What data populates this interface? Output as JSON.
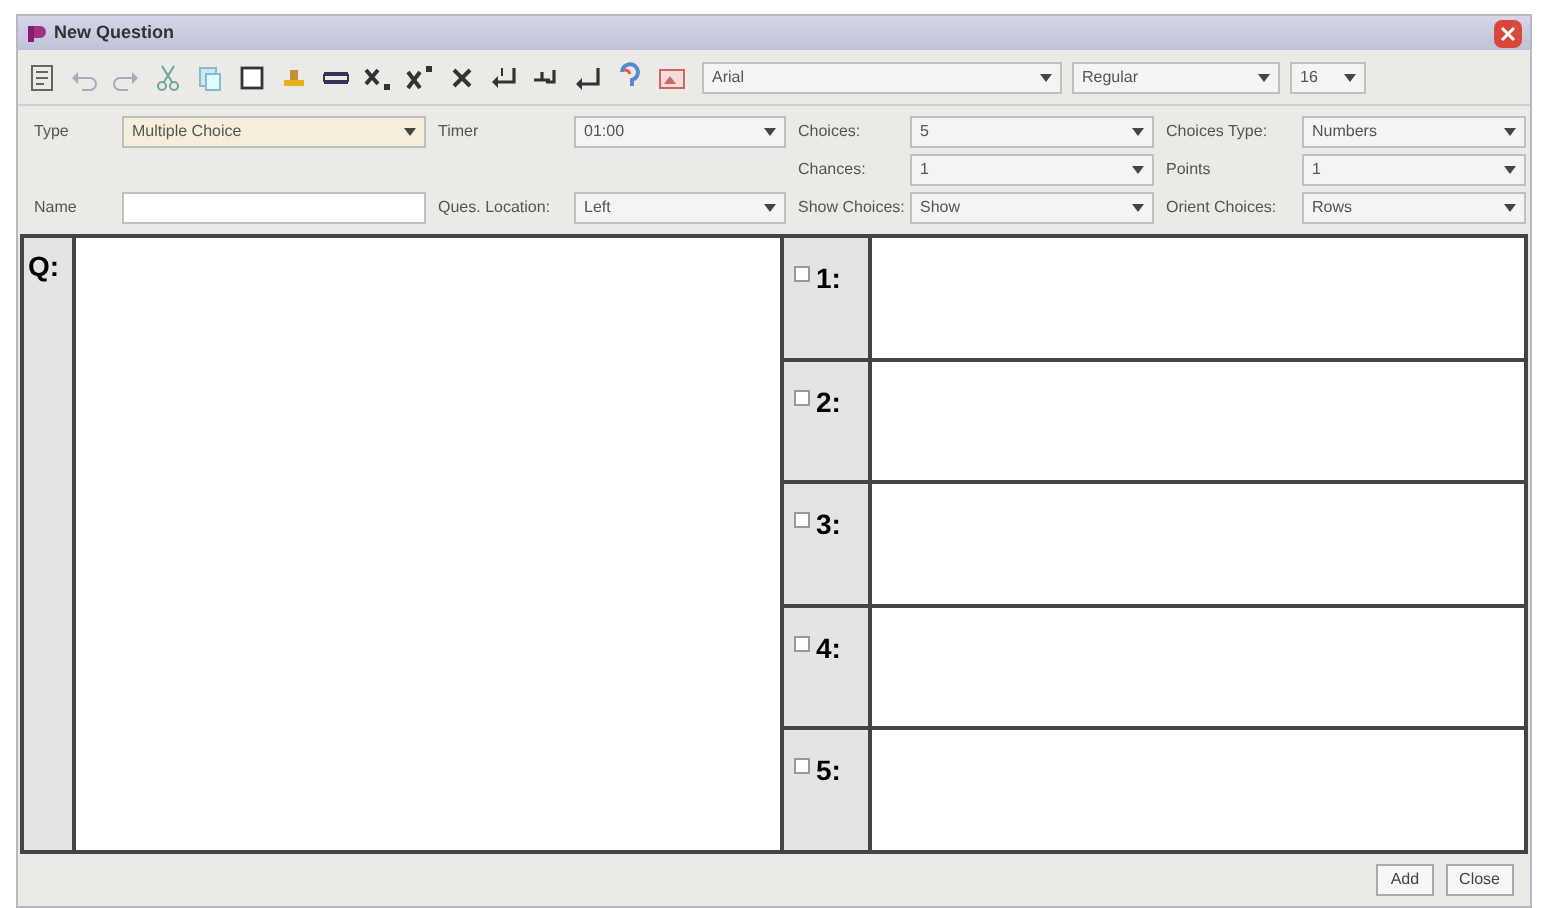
{
  "window": {
    "title": "New Question"
  },
  "font_bar": {
    "font": "Arial",
    "style": "Regular",
    "size": "16"
  },
  "form_rows": [
    [
      {
        "label": "Type",
        "value": "Multiple Choice",
        "kind": "select",
        "focused": true
      },
      {
        "label": "Timer",
        "value": "01:00",
        "kind": "select",
        "focused": false
      },
      {
        "label": "Choices:",
        "value": "5",
        "kind": "select",
        "focused": false
      },
      {
        "label": "Choices Type:",
        "value": "Numbers",
        "kind": "select",
        "focused": false
      }
    ],
    [
      null,
      null,
      {
        "label": "Chances:",
        "value": "1",
        "kind": "select",
        "focused": false
      },
      {
        "label": "Points",
        "value": "1",
        "kind": "select",
        "focused": false
      }
    ],
    [
      {
        "label": "Name",
        "kind": "text",
        "focused": false
      },
      {
        "label": "Ques. Location:",
        "value": "Left",
        "kind": "select",
        "focused": false
      },
      {
        "label": "Show Choices:",
        "value": "Show",
        "kind": "select",
        "focused": false
      },
      {
        "label": "Orient Choices:",
        "value": "Rows",
        "kind": "select",
        "focused": false
      }
    ]
  ],
  "question": {
    "label": "Q:"
  },
  "choices": [
    {
      "label": "1:",
      "checked": false
    },
    {
      "label": "2:",
      "checked": false
    },
    {
      "label": "3:",
      "checked": false
    },
    {
      "label": "4:",
      "checked": false
    },
    {
      "label": "5:",
      "checked": false
    }
  ],
  "buttons": [
    "Add",
    "Close"
  ]
}
